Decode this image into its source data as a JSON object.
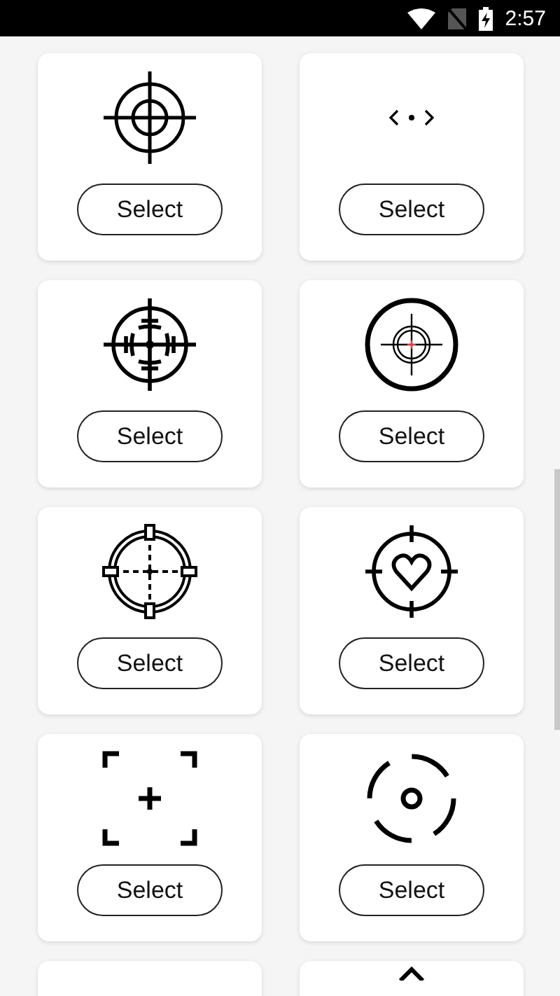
{
  "status_bar": {
    "time": "2:57"
  },
  "cards": [
    {
      "kind": "concentric",
      "button": "Select"
    },
    {
      "kind": "chevrons_dot",
      "button": "Select"
    },
    {
      "kind": "ranged",
      "button": "Select"
    },
    {
      "kind": "scope",
      "button": "Select"
    },
    {
      "kind": "dashed_ring",
      "button": "Select"
    },
    {
      "kind": "heart",
      "button": "Select"
    },
    {
      "kind": "corners",
      "button": "Select"
    },
    {
      "kind": "broken_ring",
      "button": "Select"
    },
    {
      "kind": "cut_off"
    },
    {
      "kind": "cut_off_caret"
    }
  ]
}
